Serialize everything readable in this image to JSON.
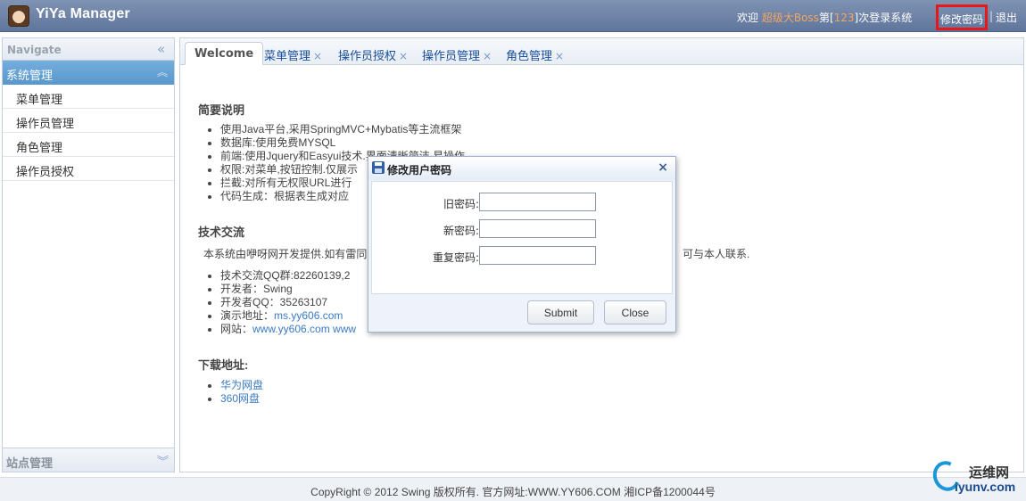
{
  "header": {
    "app_title": "YiYa Manager",
    "welcome_prefix": "欢迎",
    "user_name": "超级大Boss",
    "login_prefix": "第[",
    "login_count": "123",
    "login_suffix": "]次登录系统",
    "change_password": "修改密码",
    "separator": "|",
    "logout": "退出"
  },
  "sidebar": {
    "navigate_label": "Navigate",
    "group_title": "系统管理",
    "items": [
      "菜单管理",
      "操作员管理",
      "角色管理",
      "操作员授权"
    ],
    "site_group": "站点管理"
  },
  "tabs": {
    "welcome": "Welcome",
    "items": [
      "菜单管理",
      "操作员授权",
      "操作员管理",
      "角色管理"
    ],
    "close_glyph": "×"
  },
  "content": {
    "sec1_title": "简要说明",
    "sec1_items": [
      "使用Java平台,采用SpringMVC+Mybatis等主流框架",
      "数据库:使用免费MYSQL",
      "前端:使用Jquery和Easyui技术.界面清晰简洁,易操作",
      "权限:对菜单,按钮控制.仅展示",
      "拦截:对所有无权限URL进行",
      "代码生成：根据表生成对应"
    ],
    "sec2_title": "技术交流",
    "sec2_para": "本系统由咿呀网开发提供.如有雷同",
    "sec2_para_tail": "可与本人联系.",
    "sec2_items": {
      "qq_group": "技术交流QQ群:82260139,2",
      "developer": "开发者：Swing",
      "dev_qq": "开发者QQ：35263107",
      "demo_label": "演示地址：",
      "demo_link": "ms.yy606.com",
      "site_label": "网站：",
      "site_link": "www.yy606.com www"
    },
    "sec3_title": "下载地址:",
    "downloads": [
      "华为网盘",
      "360网盘"
    ]
  },
  "dialog": {
    "title": "修改用户密码",
    "close_glyph": "×",
    "old_label": "旧密码:",
    "new_label": "新密码:",
    "repeat_label": "重复密码:",
    "submit": "Submit",
    "close": "Close"
  },
  "footer": {
    "text": "CopyRight © 2012 Swing 版权所有.  官方网址:WWW.YY606.COM   湘ICP备1200044号"
  },
  "watermark": {
    "cn": "运维网",
    "en": "iyunv.com"
  }
}
